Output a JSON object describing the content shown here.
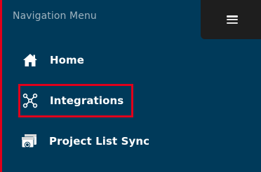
{
  "nav": {
    "title": "Navigation Menu",
    "toggle_icon": "hamburger-icon",
    "items": [
      {
        "label": "Home",
        "icon": "home-icon"
      },
      {
        "label": "Integrations",
        "icon": "integrations-icon",
        "highlighted": true
      },
      {
        "label": "Project List Sync",
        "icon": "project-sync-icon"
      }
    ]
  },
  "colors": {
    "sidebar_bg": "#003a5a",
    "toggle_bg": "#1e1e1e",
    "highlight": "#e0001b",
    "text": "#ffffff",
    "muted_text": "#9fb3bf"
  }
}
